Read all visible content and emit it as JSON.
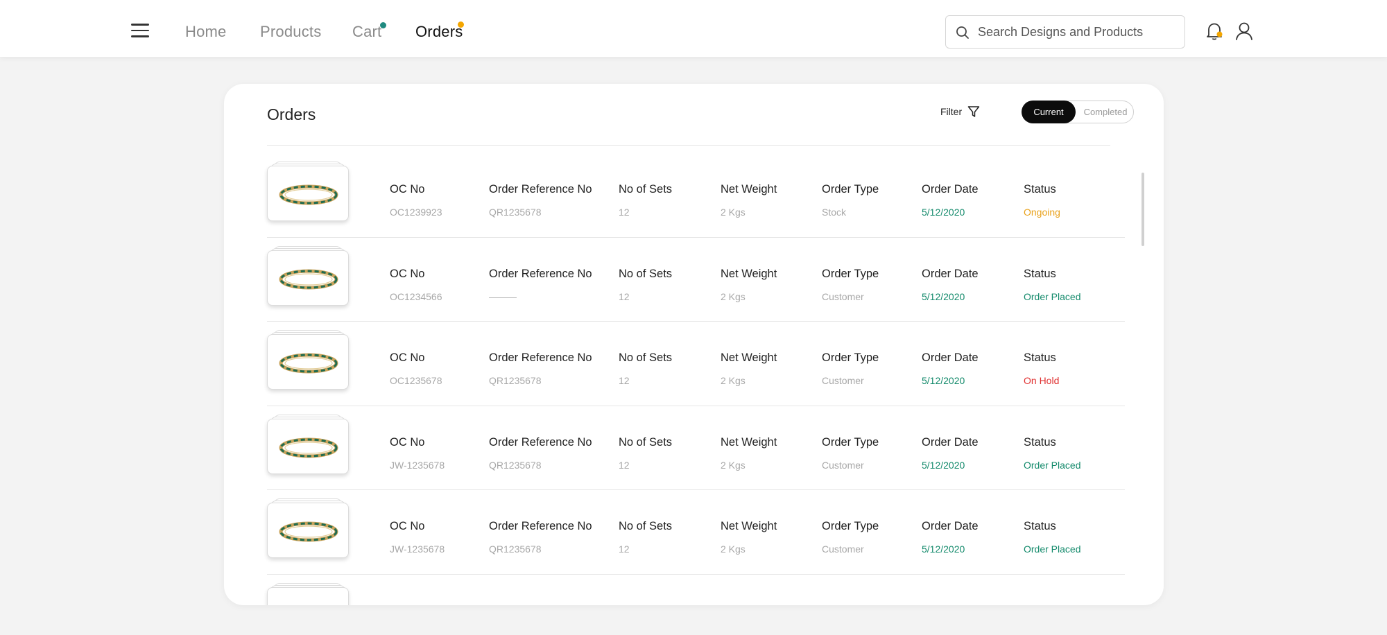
{
  "nav": {
    "links": [
      "Home",
      "Products",
      "Cart",
      "Orders"
    ],
    "search_placeholder": "Search Designs and Products"
  },
  "colors": {
    "cart_dot": "#1f8a80",
    "orders_dot": "#f4a600",
    "bell_dot": "#f4a600",
    "date_green": "#138a6b",
    "status_ongoing": "#e9a21c",
    "status_placed": "#138a6b",
    "status_hold": "#e03131"
  },
  "icons": {
    "menu": "hamburger-icon",
    "search": "search-icon",
    "bell": "bell-icon",
    "user": "user-icon",
    "filter": "filter-funnel-icon",
    "product": "bangle-icon"
  },
  "orders": {
    "title": "Orders",
    "filter_label": "Filter",
    "toggle": {
      "current": "Current",
      "completed": "Completed",
      "selected": "Current"
    },
    "headers": {
      "oc_no": "OC No",
      "order_ref": "Order Reference No",
      "sets": "No of Sets",
      "weight": "Net Weight",
      "type": "Order Type",
      "date": "Order Date",
      "status": "Status"
    },
    "rows": [
      {
        "oc_no": "OC1239923",
        "order_ref": "QR1235678",
        "sets": "12",
        "weight": "2 Kgs",
        "type": "Stock",
        "date": "5/12/2020",
        "status": "Ongoing"
      },
      {
        "oc_no": "OC1234566",
        "order_ref": "",
        "sets": "12",
        "weight": "2 Kgs",
        "type": "Customer",
        "date": "5/12/2020",
        "status": "Order Placed"
      },
      {
        "oc_no": "OC1235678",
        "order_ref": "QR1235678",
        "sets": "12",
        "weight": "2 Kgs",
        "type": "Customer",
        "date": "5/12/2020",
        "status": "On Hold"
      },
      {
        "oc_no": "JW-1235678",
        "order_ref": "QR1235678",
        "sets": "12",
        "weight": "2 Kgs",
        "type": "Customer",
        "date": "5/12/2020",
        "status": "Order Placed"
      },
      {
        "oc_no": "JW-1235678",
        "order_ref": "QR1235678",
        "sets": "12",
        "weight": "2 Kgs",
        "type": "Customer",
        "date": "5/12/2020",
        "status": "Order Placed"
      },
      {
        "oc_no": "",
        "order_ref": "",
        "sets": "",
        "weight": "",
        "type": "",
        "date": "",
        "status": ""
      }
    ]
  }
}
